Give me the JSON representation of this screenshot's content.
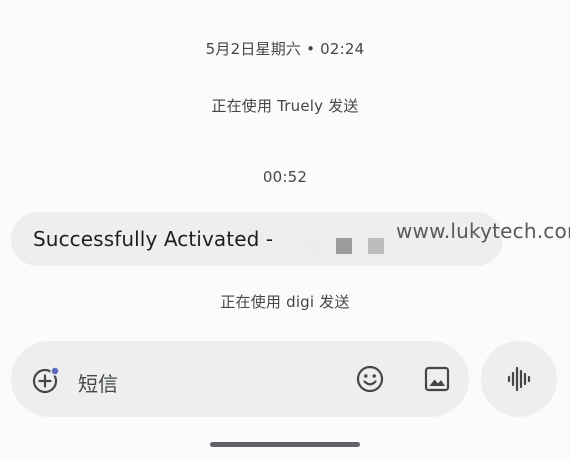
{
  "conversation": {
    "timestamp_1": "5月2日星期六 • 02:24",
    "sim_info_1": "正在使用 Truely 发送",
    "timestamp_2": "00:52",
    "message_text": "Successfully Activated -",
    "sim_info_2": "正在使用 digi 发送"
  },
  "watermark": "www.lukytech.com",
  "compose": {
    "placeholder": "短信",
    "icons": {
      "add": "add-circle-icon",
      "emoji": "emoji-icon",
      "gallery": "image-gallery-icon",
      "voice": "voice-waveform-icon"
    },
    "badge_color": "#5c6bc0"
  },
  "colors": {
    "background": "#fbfbfd",
    "bubble": "#eceef0",
    "text_secondary": "#444746"
  }
}
